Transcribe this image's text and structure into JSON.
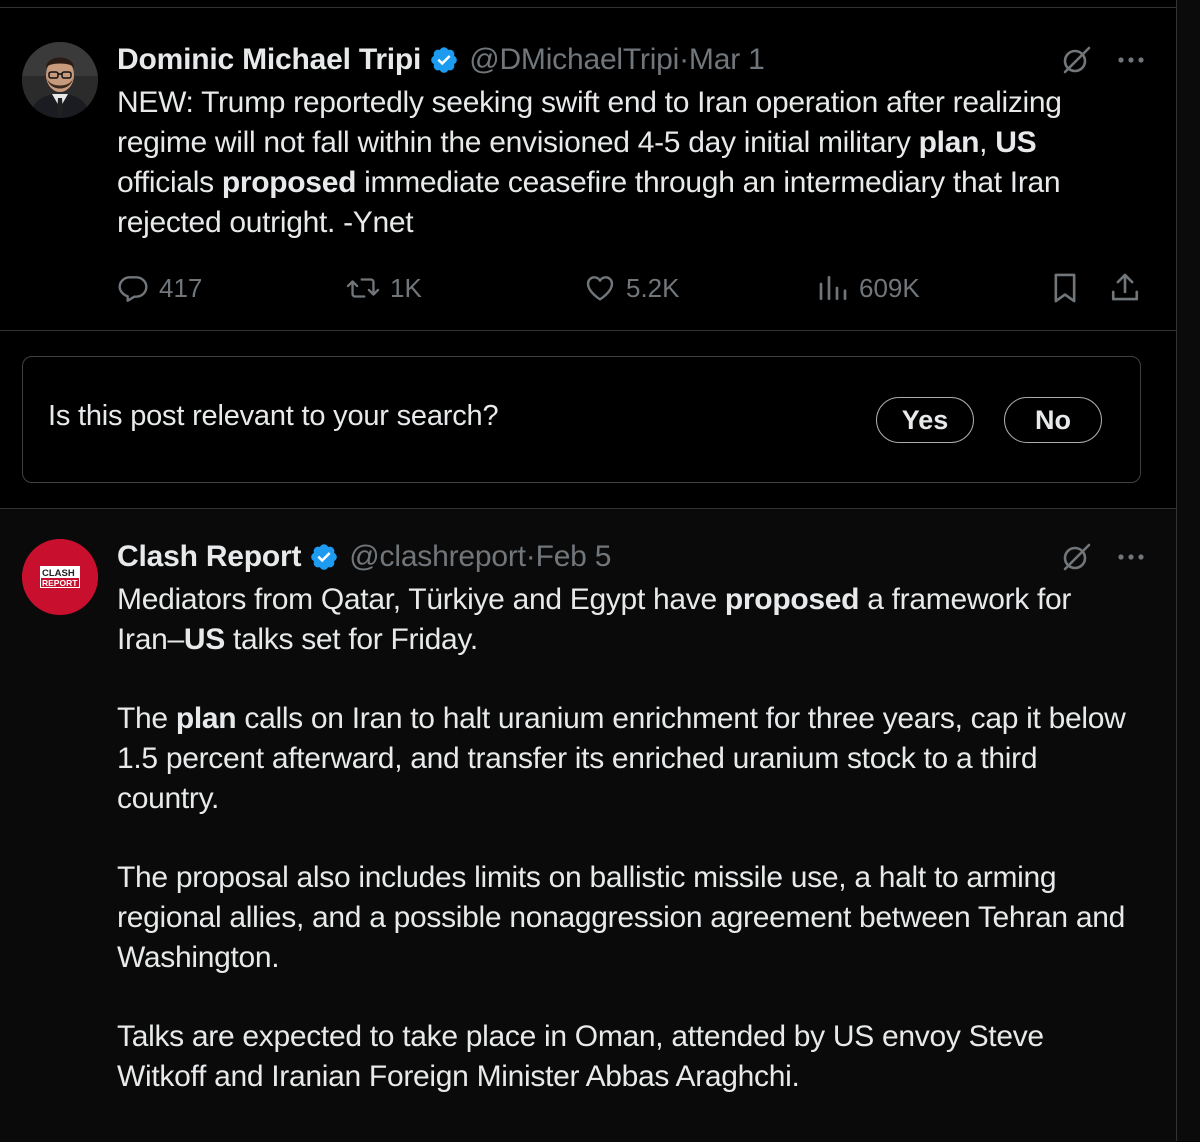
{
  "posts": [
    {
      "author": {
        "name": "Dominic Michael Tripi",
        "handle": "@DMichaelTripi",
        "date": "Mar 1",
        "verified": true
      },
      "body": [
        [
          {
            "t": "NEW: Trump reportedly seeking swift end to Iran operation after realizing regime will not fall within the envisioned 4-5 day initial military "
          },
          {
            "t": "plan",
            "b": true
          },
          {
            "t": ", "
          },
          {
            "t": "US",
            "b": true
          },
          {
            "t": " officials "
          },
          {
            "t": "proposed",
            "b": true
          },
          {
            "t": " immediate ceasefire through an intermediary that Iran rejected outright. -Ynet"
          }
        ]
      ],
      "stats": {
        "replies": "417",
        "reposts": "1K",
        "likes": "5.2K",
        "views": "609K"
      }
    },
    {
      "author": {
        "name": "Clash Report",
        "handle": "@clashreport",
        "date": "Feb 5",
        "verified": true,
        "avatar_text_top": "CLASH",
        "avatar_text_bottom": "REPORT"
      },
      "body": [
        [
          {
            "t": "Mediators from Qatar, Türkiye and Egypt have "
          },
          {
            "t": "proposed",
            "b": true
          },
          {
            "t": " a framework for Iran–"
          },
          {
            "t": "US",
            "b": true
          },
          {
            "t": " talks set for Friday."
          }
        ],
        [
          {
            "t": "The "
          },
          {
            "t": "plan",
            "b": true
          },
          {
            "t": " calls on Iran to halt uranium enrichment for three years, cap it below 1.5 percent afterward, and transfer its enriched uranium stock to a third country."
          }
        ],
        [
          {
            "t": "The proposal also includes limits on ballistic missile use, a halt to arming regional allies, and a possible nonaggression agreement between Tehran and Washington."
          }
        ],
        [
          {
            "t": "Talks are expected to take place in Oman, attended by US envoy Steve Witkoff and Iranian Foreign Minister Abbas Araghchi."
          }
        ]
      ]
    }
  ],
  "relevance_prompt": {
    "question": "Is this post relevant to your search?",
    "yes_label": "Yes",
    "no_label": "No"
  },
  "header_separator": "·",
  "icons": {
    "verified": "verified-badge-icon",
    "grok": "grok-icon",
    "more": "more-icon",
    "reply": "reply-icon",
    "repost": "repost-icon",
    "like": "heart-icon",
    "views": "views-icon",
    "bookmark": "bookmark-icon",
    "share": "share-icon"
  },
  "colors": {
    "background": "#000000",
    "text": "#e7e9ea",
    "muted": "#71767b",
    "verified": "#1d9bf0",
    "border": "#2f3336",
    "clash_red": "#c8102e"
  }
}
